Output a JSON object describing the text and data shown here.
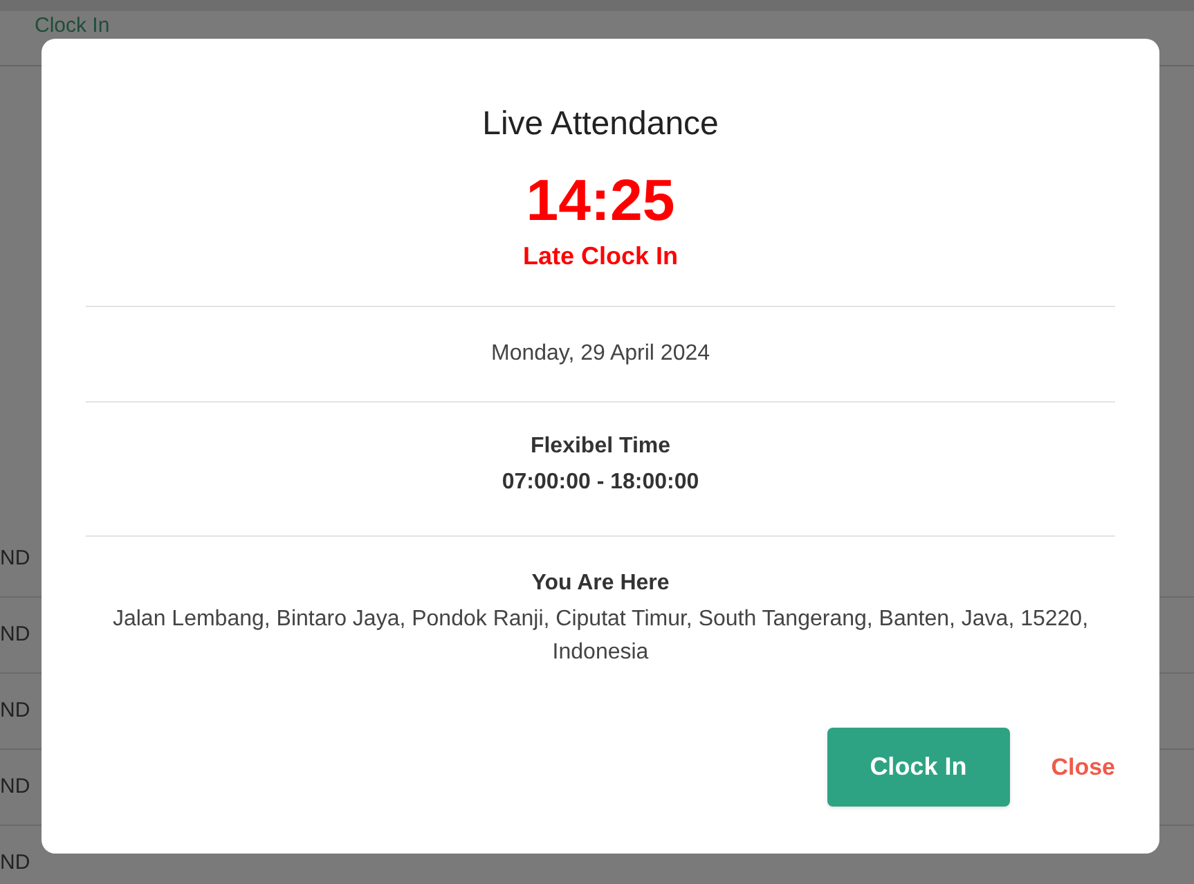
{
  "background_table": {
    "header": "Clock In",
    "rows": [
      "ND",
      "ND",
      "ND",
      "ND",
      "ND"
    ]
  },
  "dialog": {
    "title": "Live Attendance",
    "time": "14:25",
    "status": "Late Clock In",
    "date": "Monday, 29 April 2024",
    "schedule": {
      "label": "Flexibel Time",
      "hours": "07:00:00 - 18:00:00"
    },
    "location": {
      "label": "You Are Here",
      "address": "Jalan Lembang, Bintaro Jaya, Pondok Ranji, Ciputat Timur, South Tangerang, Banten, Java, 15220, Indonesia"
    },
    "buttons": [
      {
        "kind": "primary",
        "label": "Clock In"
      },
      {
        "kind": "link",
        "label": "Close"
      }
    ]
  }
}
